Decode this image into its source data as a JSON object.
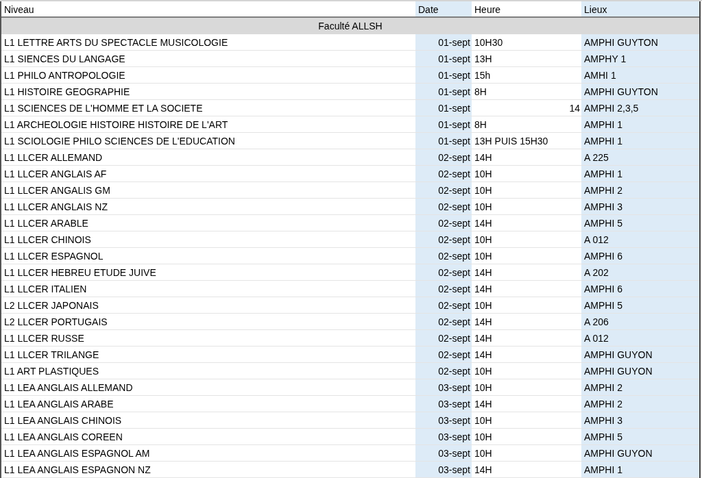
{
  "table": {
    "columns": [
      "Niveau",
      "Date",
      "Heure",
      "Lieux"
    ],
    "group": "Faculté ALLSH",
    "rows": [
      {
        "kind": "text",
        "niveau": "L1 LETTRE ARTS DU SPECTACLE MUSICOLOGIE",
        "date": "01-sept",
        "heure": "10H30",
        "lieux": "AMPHI GUYTON"
      },
      {
        "kind": "text",
        "niveau": "L1 SIENCES DU LANGAGE",
        "date": "01-sept",
        "heure": "13H",
        "lieux": "AMPHY 1"
      },
      {
        "kind": "text",
        "niveau": "L1 PHILO ANTROPOLOGIE",
        "date": "01-sept",
        "heure": "15h",
        "lieux": "AMHI 1"
      },
      {
        "kind": "text",
        "niveau": "L1 HISTOIRE GEOGRAPHIE",
        "date": "01-sept",
        "heure": "8H",
        "lieux": "AMPHI GUYTON"
      },
      {
        "kind": "number",
        "niveau": "L1 SCIENCES DE L'HOMME ET LA SOCIETE",
        "date": "01-sept",
        "heure": "14",
        "lieux": "AMPHI 2,3,5"
      },
      {
        "kind": "text",
        "niveau": "L1 ARCHEOLOGIE HISTOIRE HISTOIRE DE L'ART",
        "date": "01-sept",
        "heure": "8H",
        "lieux": "AMPHI 1"
      },
      {
        "kind": "text",
        "niveau": "L1 SCIOLOGIE PHILO SCIENCES DE L'EDUCATION",
        "date": "01-sept",
        "heure": "13H PUIS 15H30",
        "lieux": "AMPHI 1"
      },
      {
        "kind": "text",
        "niveau": "L1 LLCER ALLEMAND",
        "date": "02-sept",
        "heure": "14H",
        "lieux": "A 225"
      },
      {
        "kind": "text",
        "niveau": "L1 LLCER ANGLAIS AF",
        "date": "02-sept",
        "heure": "10H",
        "lieux": "AMPHI 1"
      },
      {
        "kind": "text",
        "niveau": "L1 LLCER ANGALIS GM",
        "date": "02-sept",
        "heure": "10H",
        "lieux": "AMPHI 2"
      },
      {
        "kind": "text",
        "niveau": "L1 LLCER ANGLAIS NZ",
        "date": "02-sept",
        "heure": "10H",
        "lieux": "AMPHI 3"
      },
      {
        "kind": "text",
        "niveau": "L1 LLCER ARABLE",
        "date": "02-sept",
        "heure": "14H",
        "lieux": "AMPHI 5"
      },
      {
        "kind": "text",
        "niveau": "L1 LLCER CHINOIS",
        "date": "02-sept",
        "heure": "10H",
        "lieux": "A 012"
      },
      {
        "kind": "text",
        "niveau": "L1 LLCER ESPAGNOL",
        "date": "02-sept",
        "heure": "10H",
        "lieux": "AMPHI 6"
      },
      {
        "kind": "text",
        "niveau": "L1 LLCER HEBREU ETUDE JUIVE",
        "date": "02-sept",
        "heure": "14H",
        "lieux": "A 202"
      },
      {
        "kind": "text",
        "niveau": "L1 LLCER ITALIEN",
        "date": "02-sept",
        "heure": "14H",
        "lieux": "AMPHI 6"
      },
      {
        "kind": "text",
        "niveau": "L2 LLCER JAPONAIS",
        "date": "02-sept",
        "heure": "10H",
        "lieux": "AMPHI 5"
      },
      {
        "kind": "text",
        "niveau": "L2 LLCER PORTUGAIS",
        "date": "02-sept",
        "heure": "14H",
        "lieux": "A 206"
      },
      {
        "kind": "text",
        "niveau": "L1 LLCER RUSSE",
        "date": "02-sept",
        "heure": "14H",
        "lieux": "A 012"
      },
      {
        "kind": "text",
        "niveau": "L1 LLCER TRILANGE",
        "date": "02-sept",
        "heure": "14H",
        "lieux": "AMPHI GUYON"
      },
      {
        "kind": "text",
        "niveau": "L1 ART PLASTIQUES",
        "date": "02-sept",
        "heure": "10H",
        "lieux": "AMPHI GUYON"
      },
      {
        "kind": "text",
        "niveau": "L1 LEA ANGLAIS ALLEMAND",
        "date": "03-sept",
        "heure": "10H",
        "lieux": "AMPHI 2"
      },
      {
        "kind": "text",
        "niveau": "L1 LEA ANGLAIS ARABE",
        "date": "03-sept",
        "heure": "14H",
        "lieux": "AMPHI 2"
      },
      {
        "kind": "text",
        "niveau": "L1 LEA ANGLAIS CHINOIS",
        "date": "03-sept",
        "heure": "10H",
        "lieux": "AMPHI 3"
      },
      {
        "kind": "text",
        "niveau": "L1 LEA ANGLAIS COREEN",
        "date": "03-sept",
        "heure": "10H",
        "lieux": "AMPHI 5"
      },
      {
        "kind": "text",
        "niveau": "L1 LEA ANGLAIS ESPAGNOL AM",
        "date": "03-sept",
        "heure": "10H",
        "lieux": "AMPHI GUYON"
      },
      {
        "kind": "text",
        "niveau": "L1 LEA ANGLAIS ESPAGNON NZ",
        "date": "03-sept",
        "heure": "14H",
        "lieux": "AMPHI 1"
      }
    ]
  }
}
